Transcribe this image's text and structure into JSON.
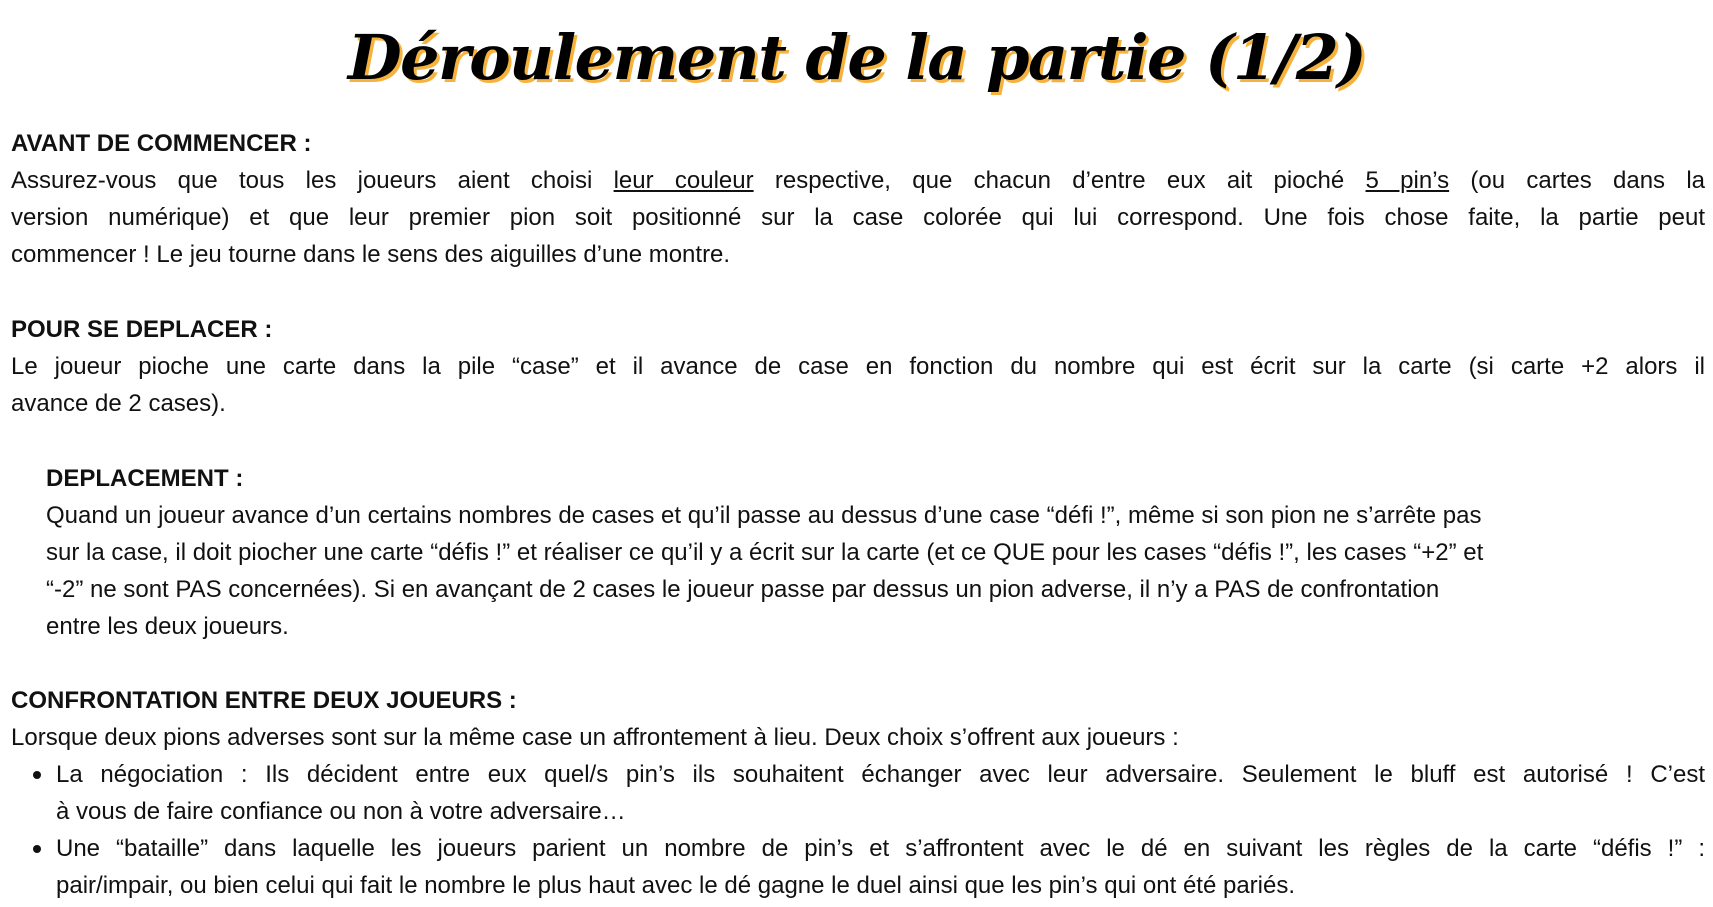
{
  "title": "Déroulement de la partie (1/2)",
  "avant": {
    "heading": "AVANT DE COMMENCER :",
    "line1": [
      "Assurez-vous que tous les joueurs aient choisi ",
      "leur couleur",
      " respective, que chacun d’entre eux ait pioché ",
      "5 pin’s",
      " (ou cartes dans la"
    ],
    "lines": [
      "version numérique) et que leur premier pion soit positionné sur la case colorée qui lui correspond. Une fois chose faite, la partie peut",
      "commencer ! Le jeu tourne dans le sens des aiguilles d’une montre."
    ]
  },
  "deplacer": {
    "heading": "POUR SE DEPLACER :",
    "lines": [
      "Le joueur pioche une carte dans la pile “case” et il avance de case en fonction du nombre qui est écrit sur la carte (si carte +2 alors il",
      "avance de 2 cases)."
    ]
  },
  "deplacement": {
    "heading": "DEPLACEMENT :",
    "lines": [
      "Quand un joueur avance d’un certains nombres de cases et qu’il passe au dessus d’une case “défi !”, même si son pion ne s’arrête pas",
      "sur la case,  il doit piocher une carte “défis !” et réaliser ce qu’il y a écrit sur la carte (et ce QUE pour les cases “défis !”, les cases “+2” et",
      "“-2” ne sont PAS concernées). Si en avançant de 2 cases le joueur passe par dessus un pion adverse, il n’y a PAS de confrontation",
      "entre les deux joueurs."
    ]
  },
  "confrontation": {
    "heading": "CONFRONTATION ENTRE DEUX JOUEURS :",
    "intro": "Lorsque deux pions adverses sont sur la même case un affrontement à lieu. Deux choix s’offrent aux joueurs :",
    "bullets": [
      [
        "La négociation : Ils décident entre eux quel/s pin’s ils souhaitent échanger avec leur adversaire. Seulement le bluff est autorisé ! C’est",
        "à vous de faire confiance ou non à votre adversaire…"
      ],
      [
        "Une “bataille” dans laquelle les joueurs parient un nombre de pin’s et s’affrontent avec le dé en suivant les règles de la carte “défis !” :",
        "pair/impair, ou bien celui qui fait le nombre le plus haut avec le dé gagne le duel ainsi que les pin’s qui ont été pariés."
      ]
    ]
  }
}
